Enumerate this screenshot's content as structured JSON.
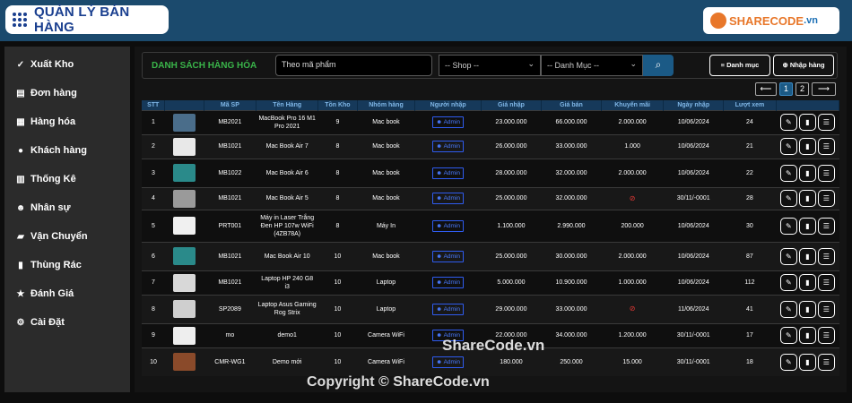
{
  "header": {
    "app_title": "QUẢN LÝ BÁN HÀNG",
    "logo_main": "SHARECODE",
    "logo_tail": ".vn"
  },
  "sidebar": {
    "items": [
      {
        "icon": "check-icon",
        "glyph": "✓",
        "label": "Xuất Kho"
      },
      {
        "icon": "document-icon",
        "glyph": "▤",
        "label": "Đơn hàng"
      },
      {
        "icon": "box-icon",
        "glyph": "▦",
        "label": "Hàng hóa"
      },
      {
        "icon": "user-icon",
        "glyph": "●",
        "label": "Khách hàng"
      },
      {
        "icon": "bar-chart-icon",
        "glyph": "▥",
        "label": "Thống Kê"
      },
      {
        "icon": "users-icon",
        "glyph": "☻",
        "label": "Nhân sự"
      },
      {
        "icon": "truck-icon",
        "glyph": "▰",
        "label": "Vận Chuyển"
      },
      {
        "icon": "trash-icon",
        "glyph": "▮",
        "label": "Thùng Rác"
      },
      {
        "icon": "star-icon",
        "glyph": "★",
        "label": "Đánh Giá"
      },
      {
        "icon": "gear-icon",
        "glyph": "⚙",
        "label": "Cài Đặt"
      }
    ]
  },
  "toolbar": {
    "title": "DANH SÁCH HÀNG HÓA",
    "search_value": "Theo mã phẩm",
    "shop_select": "-- Shop --",
    "category_select": "-- Danh Mục --",
    "category_button": "Danh mục",
    "import_button": "Nhập hàng"
  },
  "pagination": {
    "prev": "⟵",
    "pages": [
      "1",
      "2"
    ],
    "next": "⟶",
    "active": "1"
  },
  "table": {
    "headers": [
      "STT",
      "",
      "Mã SP",
      "Tên Hàng",
      "Tồn Kho",
      "Nhóm hàng",
      "Người nhập",
      "Giá nhập",
      "Giá bán",
      "Khuyến mãi",
      "Ngày nhập",
      "Lượt xem",
      ""
    ],
    "rows": [
      {
        "stt": "1",
        "thumb": "#4a6d8a",
        "code": "MB2021",
        "name": "MacBook Pro 16 M1 Pro 2021",
        "stock": "9",
        "group": "Mac book",
        "user": "Admin",
        "cost": "23.000.000",
        "price": "66.000.000",
        "promo": "2.000.000",
        "date": "10/06/2024",
        "views": "24"
      },
      {
        "stt": "2",
        "thumb": "#e8e8e8",
        "code": "MB1021",
        "name": "Mac Book Air 7",
        "stock": "8",
        "group": "Mac book",
        "user": "Admin",
        "cost": "26.000.000",
        "price": "33.000.000",
        "promo": "1.000",
        "date": "10/06/2024",
        "views": "21"
      },
      {
        "stt": "3",
        "thumb": "#2a8a8a",
        "code": "MB1022",
        "name": "Mac Book Air 6",
        "stock": "8",
        "group": "Mac book",
        "user": "Admin",
        "cost": "28.000.000",
        "price": "32.000.000",
        "promo": "2.000.000",
        "date": "10/06/2024",
        "views": "22"
      },
      {
        "stt": "4",
        "thumb": "#9a9a9a",
        "code": "MB1021",
        "name": "Mac Book Air 5",
        "stock": "8",
        "group": "Mac book",
        "user": "Admin",
        "cost": "25.000.000",
        "price": "32.000.000",
        "promo": "",
        "date": "30/11/-0001",
        "views": "28"
      },
      {
        "stt": "5",
        "thumb": "#f0f0f0",
        "code": "PRT001",
        "name": "Máy in Laser Trắng Đen HP 107w WiFi (4ZB78A)",
        "stock": "8",
        "group": "Máy In",
        "user": "Admin",
        "cost": "1.100.000",
        "price": "2.990.000",
        "promo": "200.000",
        "date": "10/06/2024",
        "views": "30"
      },
      {
        "stt": "6",
        "thumb": "#2a8a8a",
        "code": "MB1021",
        "name": "Mac Book Air 10",
        "stock": "10",
        "group": "Mac book",
        "user": "Admin",
        "cost": "25.000.000",
        "price": "30.000.000",
        "promo": "2.000.000",
        "date": "10/06/2024",
        "views": "87"
      },
      {
        "stt": "7",
        "thumb": "#d8d8d8",
        "code": "MB1021",
        "name": "Laptop HP 240 G8 i3",
        "stock": "10",
        "group": "Laptop",
        "user": "Admin",
        "cost": "5.000.000",
        "price": "10.900.000",
        "promo": "1.000.000",
        "date": "10/06/2024",
        "views": "112"
      },
      {
        "stt": "8",
        "thumb": "#cfcfcf",
        "code": "SP2089",
        "name": "Laptop Asus Gaming Rog Strix",
        "stock": "10",
        "group": "Laptop",
        "user": "Admin",
        "cost": "29.000.000",
        "price": "33.000.000",
        "promo": "",
        "date": "11/06/2024",
        "views": "41"
      },
      {
        "stt": "9",
        "thumb": "#eeeeee",
        "code": "mo",
        "name": "demo1",
        "stock": "10",
        "group": "Camera WiFi",
        "user": "Admin",
        "cost": "22.000.000",
        "price": "34.000.000",
        "promo": "1.200.000",
        "date": "30/11/-0001",
        "views": "17"
      },
      {
        "stt": "10",
        "thumb": "#8a4a2a",
        "code": "CMR-WG1",
        "name": "Demo mới",
        "stock": "10",
        "group": "Camera WiFi",
        "user": "Admin",
        "cost": "180.000",
        "price": "250.000",
        "promo": "15.000",
        "date": "30/11/-0001",
        "views": "18"
      }
    ]
  },
  "watermarks": {
    "center": "ShareCode.vn",
    "bottom": "Copyright © ShareCode.vn"
  }
}
